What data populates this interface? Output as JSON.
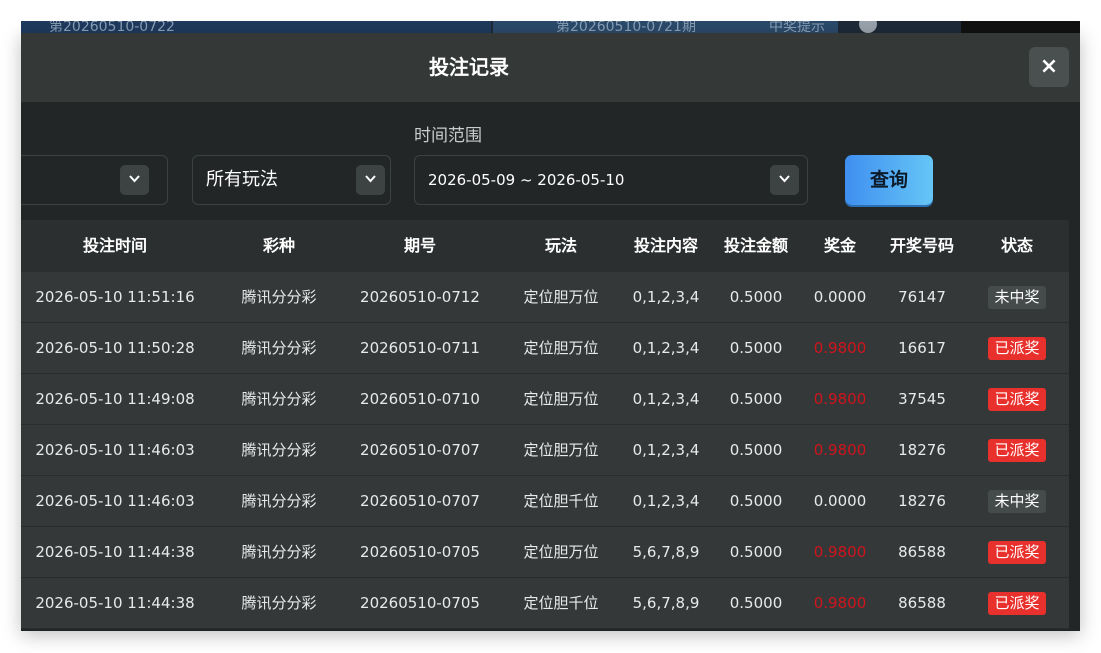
{
  "background": {
    "left_text": "第20260510-0722",
    "mid_text": "第20260510-0721期",
    "right_text": "中奖提示"
  },
  "modal": {
    "title": "投注记录",
    "close_label": "×"
  },
  "filters": {
    "lottery_select_value": "",
    "playtype_select_value": "所有玩法",
    "time_range_label": "时间范围",
    "time_range_value": "2026-05-09 ~ 2026-05-10",
    "query_button": "查询"
  },
  "table": {
    "columns": [
      "投注时间",
      "彩种",
      "期号",
      "玩法",
      "投注内容",
      "投注金额",
      "奖金",
      "开奖号码",
      "状态"
    ],
    "rows": [
      {
        "time": "2026-05-10 11:51:16",
        "lottery": "腾讯分分彩",
        "issue": "20260510-0712",
        "play": "定位胆万位",
        "content": "0,1,2,3,4",
        "amount": "0.5000",
        "prize": "0.0000",
        "prize_red": false,
        "draw": "76147",
        "status": "未中奖",
        "status_type": "none"
      },
      {
        "time": "2026-05-10 11:50:28",
        "lottery": "腾讯分分彩",
        "issue": "20260510-0711",
        "play": "定位胆万位",
        "content": "0,1,2,3,4",
        "amount": "0.5000",
        "prize": "0.9800",
        "prize_red": true,
        "draw": "16617",
        "status": "已派奖",
        "status_type": "won"
      },
      {
        "time": "2026-05-10 11:49:08",
        "lottery": "腾讯分分彩",
        "issue": "20260510-0710",
        "play": "定位胆万位",
        "content": "0,1,2,3,4",
        "amount": "0.5000",
        "prize": "0.9800",
        "prize_red": true,
        "draw": "37545",
        "status": "已派奖",
        "status_type": "won"
      },
      {
        "time": "2026-05-10 11:46:03",
        "lottery": "腾讯分分彩",
        "issue": "20260510-0707",
        "play": "定位胆万位",
        "content": "0,1,2,3,4",
        "amount": "0.5000",
        "prize": "0.9800",
        "prize_red": true,
        "draw": "18276",
        "status": "已派奖",
        "status_type": "won"
      },
      {
        "time": "2026-05-10 11:46:03",
        "lottery": "腾讯分分彩",
        "issue": "20260510-0707",
        "play": "定位胆千位",
        "content": "0,1,2,3,4",
        "amount": "0.5000",
        "prize": "0.0000",
        "prize_red": false,
        "draw": "18276",
        "status": "未中奖",
        "status_type": "none"
      },
      {
        "time": "2026-05-10 11:44:38",
        "lottery": "腾讯分分彩",
        "issue": "20260510-0705",
        "play": "定位胆万位",
        "content": "5,6,7,8,9",
        "amount": "0.5000",
        "prize": "0.9800",
        "prize_red": true,
        "draw": "86588",
        "status": "已派奖",
        "status_type": "won"
      },
      {
        "time": "2026-05-10 11:44:38",
        "lottery": "腾讯分分彩",
        "issue": "20260510-0705",
        "play": "定位胆千位",
        "content": "5,6,7,8,9",
        "amount": "0.5000",
        "prize": "0.9800",
        "prize_red": true,
        "draw": "86588",
        "status": "已派奖",
        "status_type": "won"
      }
    ]
  },
  "colors": {
    "prize_red": "#d0141c",
    "badge_won": "#e8302c",
    "badge_none": "#454a4a",
    "query_gradient_start": "#3f8ff0",
    "query_gradient_end": "#66c6f6"
  }
}
